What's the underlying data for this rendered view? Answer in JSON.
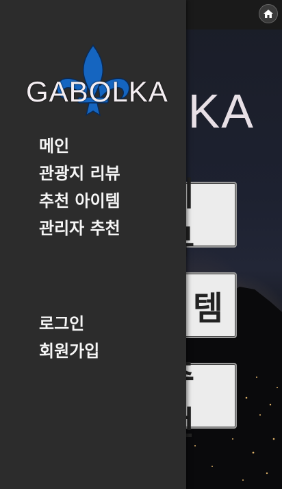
{
  "background": {
    "logo_text": "ILKA",
    "buttons": [
      "리뷰",
      "템",
      "추천"
    ]
  },
  "drawer": {
    "logo_text": "GABOLKA",
    "menu_items": [
      "메인",
      "관광지 리뷰",
      "추천 아이템",
      "관리자 추천"
    ],
    "account_items": [
      "로그인",
      "회원가입"
    ]
  },
  "colors": {
    "drawer_bg": "#2c2c2c",
    "fleur_de_lis": "#1565c0",
    "menu_text": "#f6f6f6"
  },
  "icons": [
    "home-icon",
    "fleur-de-lis-logo"
  ]
}
